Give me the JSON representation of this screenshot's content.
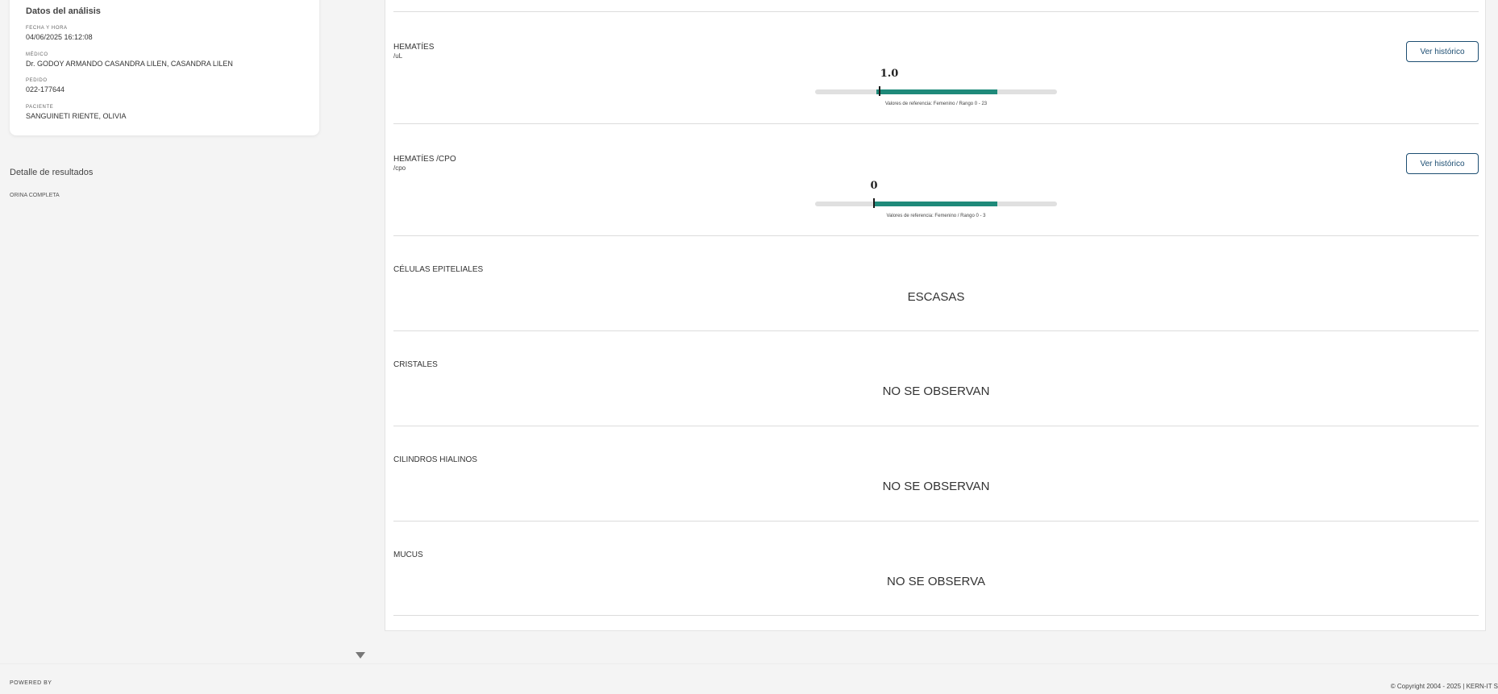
{
  "sidebar": {
    "card_title": "Datos del análisis",
    "fields": [
      {
        "label": "FECHA Y HORA",
        "value": "04/06/2025 16:12:08"
      },
      {
        "label": "MÉDICO",
        "value": "Dr. GODOY ARMANDO CASANDRA LILEN, CASANDRA LILEN"
      },
      {
        "label": "PEDIDO",
        "value": "022-177644"
      },
      {
        "label": "PACIENTE",
        "value": "SANGUINETI RIENTE, OLIVIA"
      }
    ],
    "detail_title": "Detalle de resultados",
    "detail_items": [
      "ORINA COMPLETA"
    ]
  },
  "results": [
    {
      "name": "HEMATÍES",
      "unit": "/uL",
      "button": "Ver histórico",
      "value": "1.0",
      "reference": "Valores de referencia: Femenino / Rango 0 - 23"
    },
    {
      "name": "HEMATÍES /CPO",
      "unit": "/cpo",
      "button": "Ver histórico",
      "value": "0",
      "reference": "Valores de referencia: Femenino / Rango 0 - 3"
    },
    {
      "name": "CÉLULAS EPITELIALES",
      "value": "ESCASAS"
    },
    {
      "name": "CRISTALES",
      "value": "NO SE OBSERVAN"
    },
    {
      "name": "CILINDROS HIALINOS",
      "value": "NO SE OBSERVAN"
    },
    {
      "name": "MUCUS",
      "value": "NO SE OBSERVA"
    }
  ],
  "footer": {
    "powered_by": "POWERED BY",
    "copyright": "© Copyright 2004 - 2025 | KERN-IT S"
  },
  "colors": {
    "gauge_fill": "#1f8a7a",
    "button_border": "#1d4e72"
  }
}
